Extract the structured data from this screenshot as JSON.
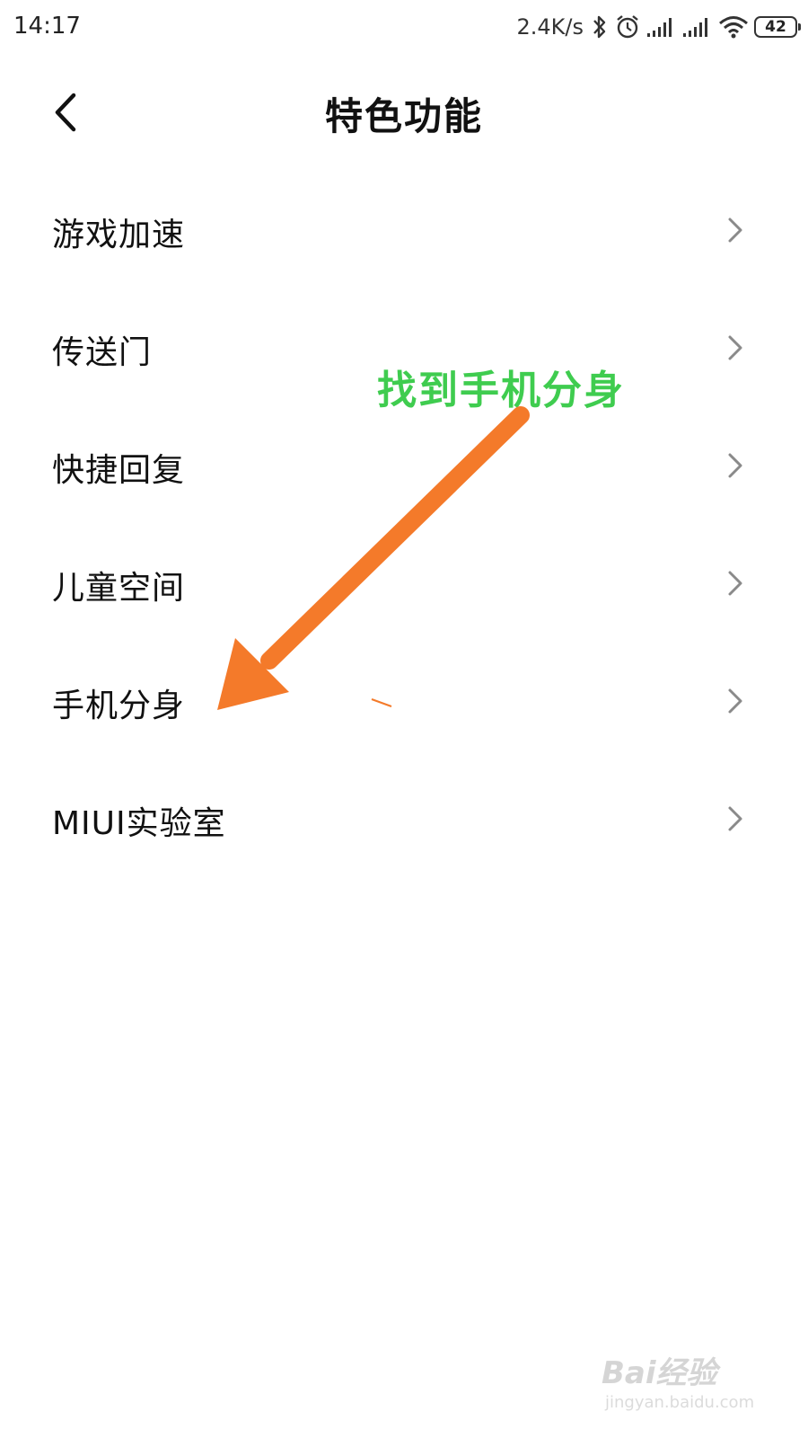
{
  "status_bar": {
    "time": "14:17",
    "net_speed": "2.4K/s",
    "battery": "42",
    "icons": [
      "bluetooth-icon",
      "alarm-icon",
      "signal-icon",
      "signal-icon",
      "wifi-icon",
      "battery-icon"
    ]
  },
  "header": {
    "title": "特色功能",
    "back_icon": "chevron-left-icon"
  },
  "menu": {
    "items": [
      {
        "label": "游戏加速"
      },
      {
        "label": "传送门"
      },
      {
        "label": "快捷回复"
      },
      {
        "label": "儿童空间"
      },
      {
        "label": "手机分身"
      },
      {
        "label": "MIUI实验室"
      }
    ]
  },
  "annotation": {
    "text": "找到手机分身",
    "text_color": "#3fcc4f",
    "arrow_color": "#f47a2a"
  },
  "watermark": {
    "brand": "Bai经验",
    "url": "jingyan.baidu.com"
  }
}
